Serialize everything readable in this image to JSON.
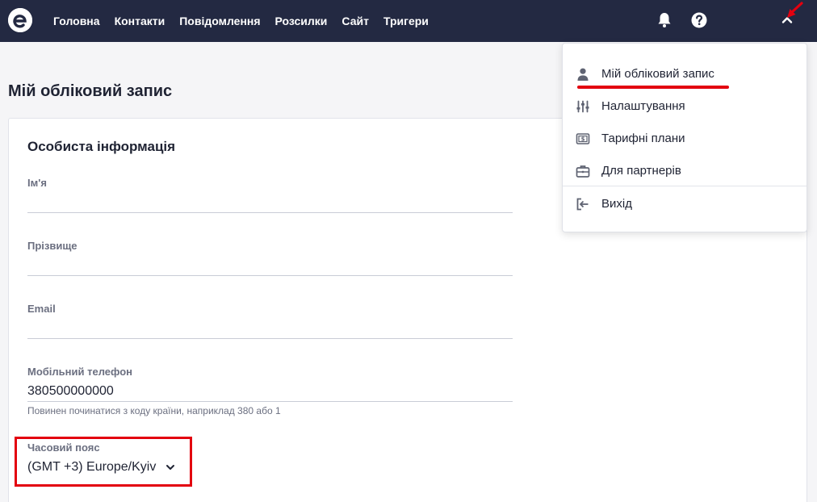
{
  "colors": {
    "topbar": "#232942",
    "accent_red": "#e3000f",
    "page_bg": "#f5f5f7"
  },
  "header": {
    "nav": [
      {
        "label": "Головна"
      },
      {
        "label": "Контакти"
      },
      {
        "label": "Повідомлення"
      },
      {
        "label": "Розсилки"
      },
      {
        "label": "Сайт"
      },
      {
        "label": "Тригери"
      }
    ],
    "icons": [
      "logo-icon",
      "bell-icon",
      "help-icon",
      "chevron-up-icon"
    ]
  },
  "page": {
    "title": "Мій обліковий запис",
    "section_title": "Особиста інформація",
    "fields": {
      "first_name": {
        "label": "Ім'я",
        "value": ""
      },
      "last_name": {
        "label": "Прізвище",
        "value": ""
      },
      "email": {
        "label": "Email",
        "value": ""
      },
      "phone": {
        "label": "Мобільний телефон",
        "value": "380500000000",
        "hint": "Повинен починатися з коду країни, наприклад 380 або 1"
      },
      "timezone": {
        "label": "Часовий пояс",
        "value": "(GMT +3) Europe/Kyiv"
      }
    }
  },
  "menu": {
    "items": [
      {
        "label": "Мій обліковий запис",
        "icon": "user-icon"
      },
      {
        "label": "Налаштування",
        "icon": "sliders-icon"
      },
      {
        "label": "Тарифні плани",
        "icon": "money-icon"
      },
      {
        "label": "Для партнерів",
        "icon": "briefcase-icon"
      },
      {
        "label": "Вихід",
        "icon": "logout-icon"
      }
    ]
  }
}
